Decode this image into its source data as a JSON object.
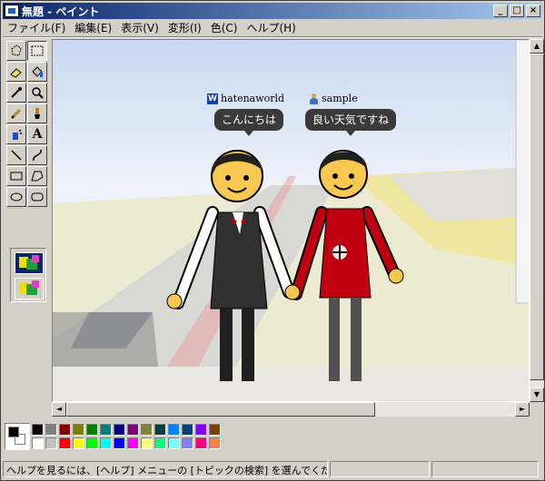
{
  "window": {
    "title": "無題 - ペイント",
    "minimize": "_",
    "maximize": "□",
    "close": "×"
  },
  "menu": [
    "ファイル(F)",
    "編集(E)",
    "表示(V)",
    "変形(I)",
    "色(C)",
    "ヘルプ(H)"
  ],
  "tools": [
    "free-select-icon",
    "rect-select-icon",
    "eraser-icon",
    "fill-icon",
    "picker-icon",
    "magnifier-icon",
    "pencil-icon",
    "brush-icon",
    "airbrush-icon",
    "text-icon",
    "line-icon",
    "curve-icon",
    "rectangle-icon",
    "polygon-icon",
    "ellipse-icon",
    "rounded-rect-icon"
  ],
  "canvas": {
    "user1": {
      "name": "hatenaworld",
      "message": "こんにちは"
    },
    "user2": {
      "name": "sample",
      "message": "良い天気ですね"
    }
  },
  "palette": {
    "foreground": "#000000",
    "background": "#ffffff",
    "colors": [
      "#000000",
      "#808080",
      "#800000",
      "#808000",
      "#008000",
      "#008080",
      "#000080",
      "#800080",
      "#808040",
      "#004040",
      "#0080ff",
      "#004080",
      "#8000ff",
      "#804000",
      "#ffffff",
      "#c0c0c0",
      "#ff0000",
      "#ffff00",
      "#00ff00",
      "#00ffff",
      "#0000ff",
      "#ff00ff",
      "#ffff80",
      "#00ff80",
      "#80ffff",
      "#8080ff",
      "#ff0080",
      "#ff8040"
    ]
  },
  "status": {
    "help_text": "ヘルプを見るには、[ヘルプ] メニューの [トピックの検索] を選んでください。"
  }
}
